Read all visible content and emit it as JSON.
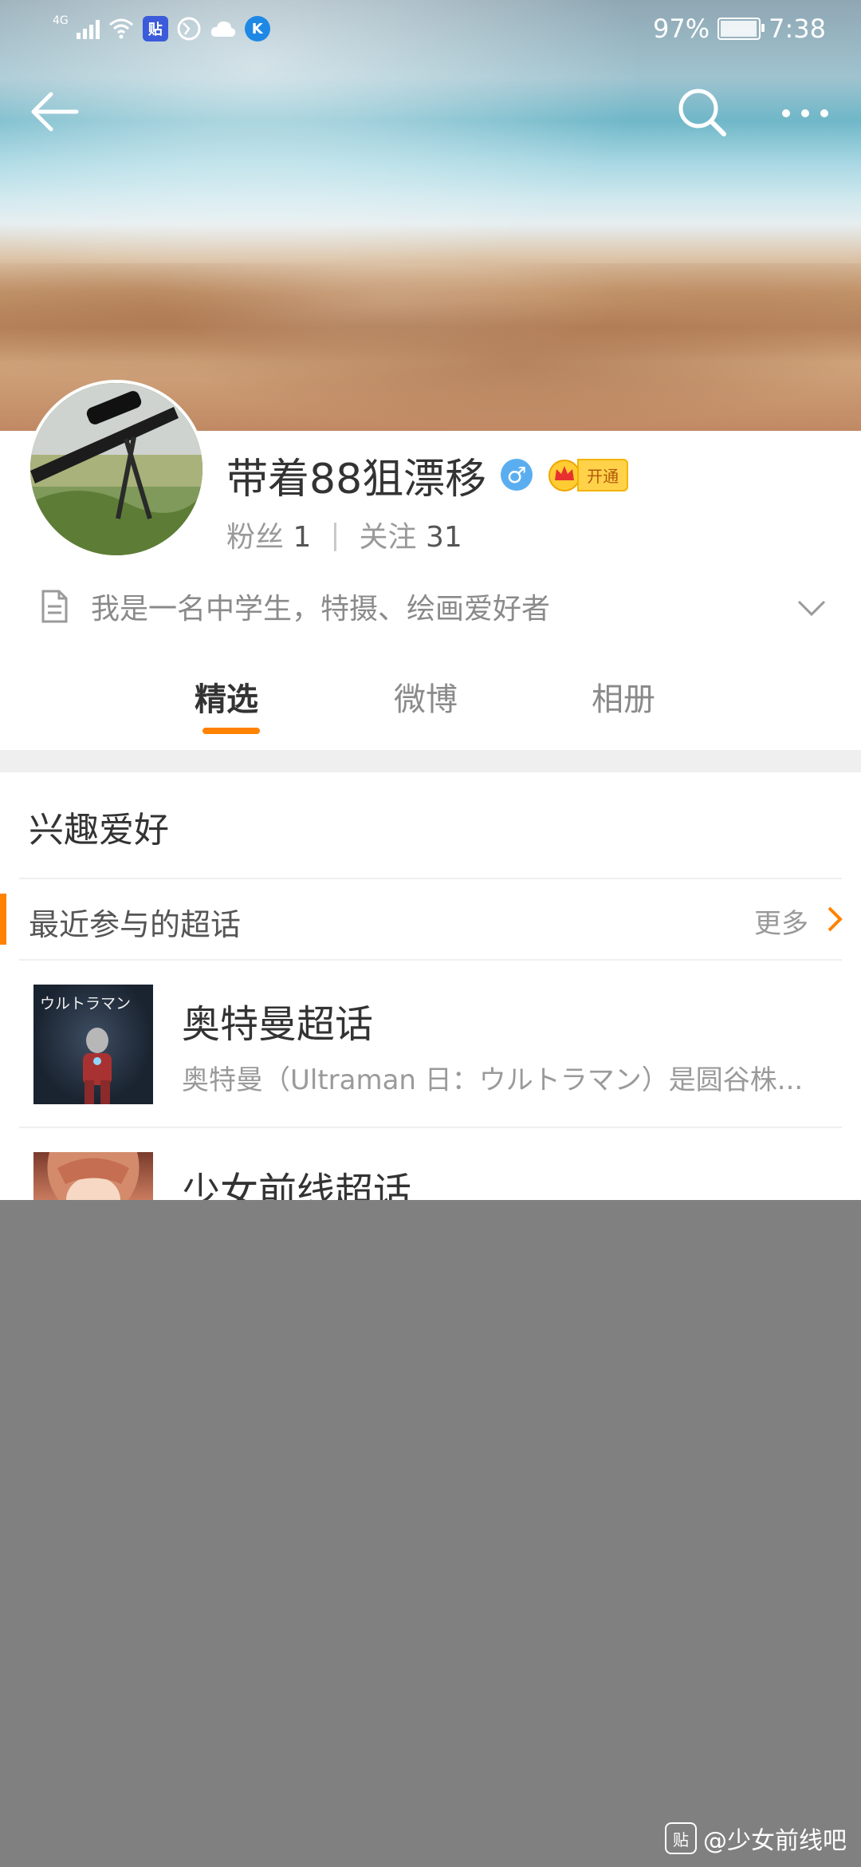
{
  "status_bar": {
    "network": "4G",
    "battery": "97%",
    "time": "7:38",
    "app_icons": [
      "tieba-icon",
      "globe-icon",
      "cloud-icon",
      "kugou-icon"
    ]
  },
  "profile": {
    "name": "带着88狙漂移",
    "gender_symbol": "♂",
    "vip_label": "开通",
    "fans_label": "粉丝",
    "fans_count": "1",
    "following_label": "关注",
    "following_count": "31",
    "bio": "我是一名中学生，特摄、绘画爱好者"
  },
  "tabs": [
    {
      "label": "精选",
      "active": true
    },
    {
      "label": "微博",
      "active": false
    },
    {
      "label": "相册",
      "active": false
    }
  ],
  "section": {
    "title": "兴趣爱好",
    "recent_label": "最近参与的超话",
    "more_label": "更多"
  },
  "topics": [
    {
      "name": "奥特曼超话",
      "desc": "奥特曼（Ultraman 日：ウルトラマン）是圆谷株...",
      "thumb_text": "ウルトラマン"
    },
    {
      "name": "少女前线超话",
      "desc": ""
    }
  ],
  "watermark": {
    "logo": "贴",
    "text": "@少女前线吧"
  },
  "colors": {
    "accent": "#ff8200",
    "overlay": "#808080"
  }
}
